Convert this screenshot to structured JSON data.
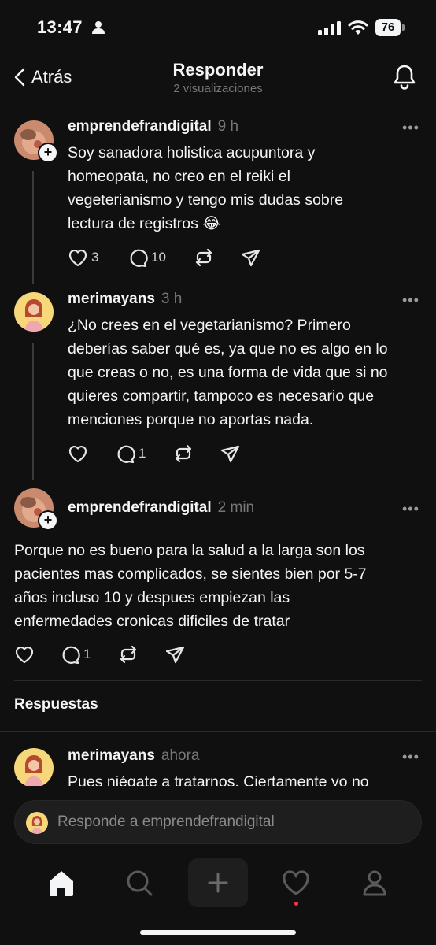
{
  "status_bar": {
    "time": "13:47",
    "battery": "76"
  },
  "header": {
    "back_label": "Atrás",
    "title": "Responder",
    "subtitle": "2 visualizaciones"
  },
  "posts": [
    {
      "username": "emprendefrandigital",
      "time": "9 h",
      "text_lines": [
        "Soy sanadora holistica acupuntora y",
        "homeopata, no creo en el reiki el",
        "vegeterianismo y tengo mis dudas sobre",
        "lectura de registros 😂"
      ],
      "likes": "3",
      "comments": "10"
    },
    {
      "username": "merimayans",
      "time": "3 h",
      "text_lines": [
        "¿No crees en el vegetarianismo? Primero",
        "deberías saber qué es, ya que no es algo en lo",
        "que creas o no, es una forma de vida que si no",
        "quieres compartir, tampoco es necesario que",
        "menciones porque no aportas nada."
      ],
      "comments": "1"
    },
    {
      "username": "emprendefrandigital",
      "time": "2 min",
      "text_lines": [
        "Porque no es bueno para la salud a la larga son los",
        "pacientes mas complicados, se sientes bien por 5-7",
        "años incluso 10 y despues empiezan las",
        "enfermedades cronicas dificiles de tratar"
      ],
      "comments": "1"
    }
  ],
  "replies_section": {
    "title": "Respuestas",
    "reply": {
      "username": "merimayans",
      "time": "ahora",
      "text_partial": "Pues niégate a tratarnos. Ciertamente yo no"
    }
  },
  "reply_bar": {
    "placeholder": "Responde a emprendefrandigital"
  },
  "more_glyph": "•••",
  "colors": {
    "background": "#101010",
    "text": "#f3f5f7",
    "muted": "#777777",
    "notification": "#ff3040"
  }
}
